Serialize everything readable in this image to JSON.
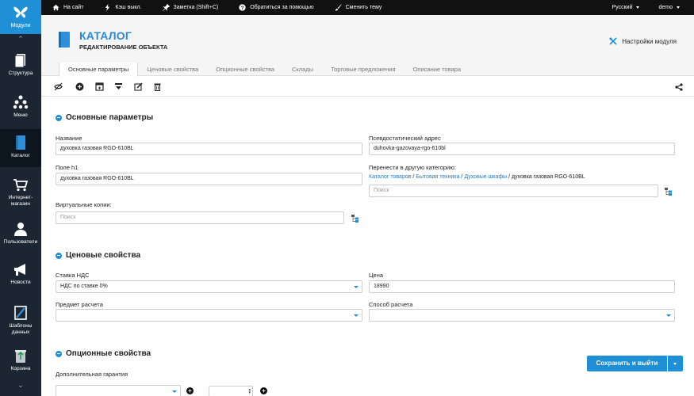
{
  "topbar": {
    "site": "На сайт",
    "cache": "Кэш выкл.",
    "note": "Заметка (Shift+C)",
    "help": "Обратиться за помощью",
    "theme": "Сменить тему",
    "language": "Русский",
    "user": "demo"
  },
  "sidebar": {
    "modules": "Модули",
    "items": [
      {
        "label": "Структура",
        "icon": "structure-icon"
      },
      {
        "label": "Меню",
        "icon": "menu-icon"
      },
      {
        "label": "Каталог",
        "icon": "catalog-icon"
      },
      {
        "label": "Интернет-магазин",
        "icon": "shop-icon"
      },
      {
        "label": "Пользователи",
        "icon": "users-icon"
      },
      {
        "label": "Новости",
        "icon": "news-icon"
      },
      {
        "label": "Шаблоны данных",
        "icon": "templates-icon"
      },
      {
        "label": "Корзина",
        "icon": "trash-icon"
      }
    ]
  },
  "header": {
    "title": "КАТАЛОГ",
    "subtitle": "РЕДАКТИРОВАНИЕ ОБЪЕКТА",
    "settings": "Настройки модуля"
  },
  "tabs": [
    "Основные параметры",
    "Ценовые свойства",
    "Опционные свойства",
    "Склады",
    "Торговые предложения",
    "Описание товара"
  ],
  "sections": {
    "main": {
      "title": "Основные параметры",
      "name_label": "Название",
      "name_value": "духовка газовая RGO-610BL",
      "h1_label": "Поле h1",
      "h1_value": "духовка газовая RGO-610BL",
      "copies_label": "Виртуальные копии:",
      "copies_placeholder": "Поиск",
      "alias_label": "Псевдостатический адрес",
      "alias_value": "duhovka-gazovaya-rgo-610bl",
      "move_label": "Перенести в другую категорию:",
      "crumb1": "Каталог товаров",
      "crumb2": "Бытовая техника",
      "crumb3": "Духовые шкафы",
      "crumb_current": "духовка газовая RGO-610BL",
      "sep": " / ",
      "move_placeholder": "Поиск"
    },
    "price": {
      "title": "Ценовые свойства",
      "vat_label": "Ставка НДС",
      "vat_value": "НДС по ставке 0%",
      "price_label": "Цена",
      "price_value": "18990",
      "subject_label": "Предмет расчета",
      "method_label": "Способ расчета"
    },
    "options": {
      "title": "Опционные свойства",
      "warranty_label": "Дополнительная гарантия"
    }
  },
  "save": {
    "label": "Сохранить и выйти"
  },
  "colors": {
    "accent": "#1f8fd6",
    "sidebar": "#1c2632",
    "topbar": "#111111"
  }
}
